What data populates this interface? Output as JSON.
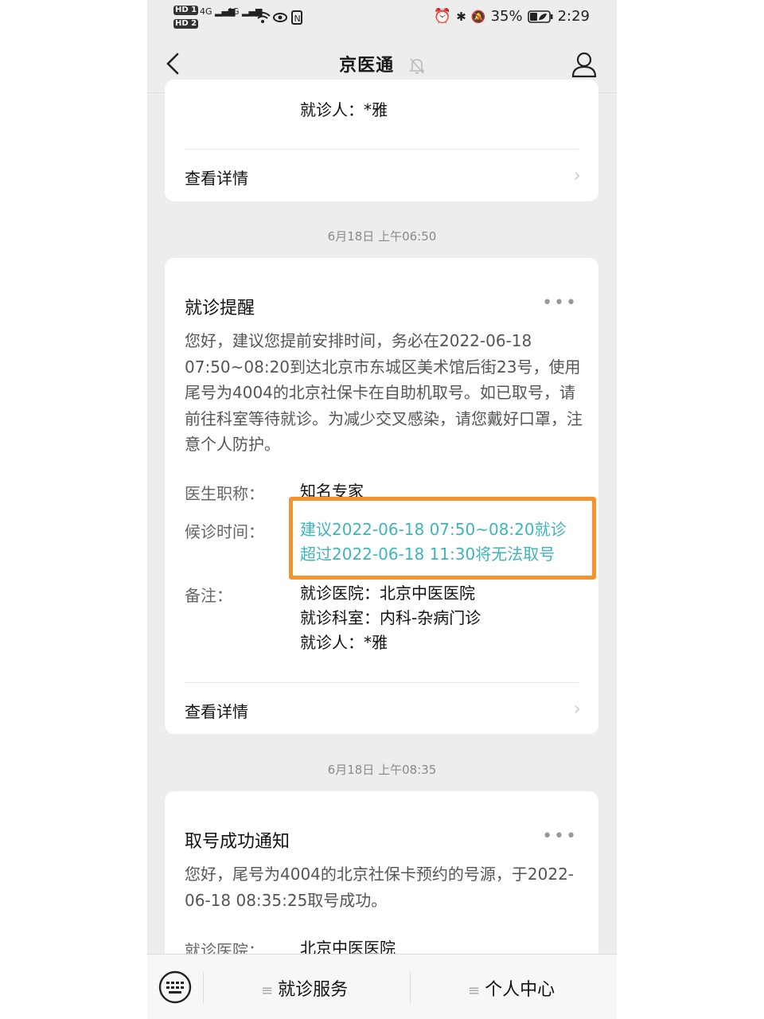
{
  "status_bar": {
    "sim1": "HD 1",
    "sim2": "HD 2",
    "net1": "4G",
    "net2": "4G",
    "battery": "35%",
    "time": "2:29"
  },
  "header": {
    "title": "京医通"
  },
  "card0": {
    "patient": "就诊人：*雅",
    "detail_link": "查看详情"
  },
  "time1": "6月18日 上午06:50",
  "card1": {
    "title": "就诊提醒",
    "menu": "•••",
    "body": "您好，建议您提前安排时间，务必在2022-06-18 07:50~08:20到达北京市东城区美术馆后街23号，使用尾号为4004的北京社保卡在自助机取号。如已取号，请前往科室等待就诊。为减少交叉感染，请您戴好口罩，注意个人防护。",
    "rows": [
      {
        "label": "医生职称：",
        "value": "知名专家"
      },
      {
        "label": "候诊时间：",
        "value_line1": "建议2022-06-18 07:50~08:20就诊",
        "value_line2": "超过2022-06-18 11:30将无法取号"
      },
      {
        "label": "备注：",
        "value_line1": "就诊医院：北京中医医院",
        "value_line2": "就诊科室：内科-杂病门诊",
        "value_line3": "就诊人：*雅"
      }
    ],
    "detail_link": "查看详情"
  },
  "time2": "6月18日 上午08:35",
  "card2": {
    "title": "取号成功通知",
    "menu": "•••",
    "body": "您好，尾号为4004的北京社保卡预约的号源，于2022-06-18 08:35:25取号成功。",
    "row_label": "就诊医院：",
    "row_value": "北京中医医院"
  },
  "bottom_bar": {
    "item1": "就诊服务",
    "item2": "个人中心"
  },
  "colors": {
    "highlight_text": "#3fb5b9",
    "annotation_box": "#f7932f"
  }
}
